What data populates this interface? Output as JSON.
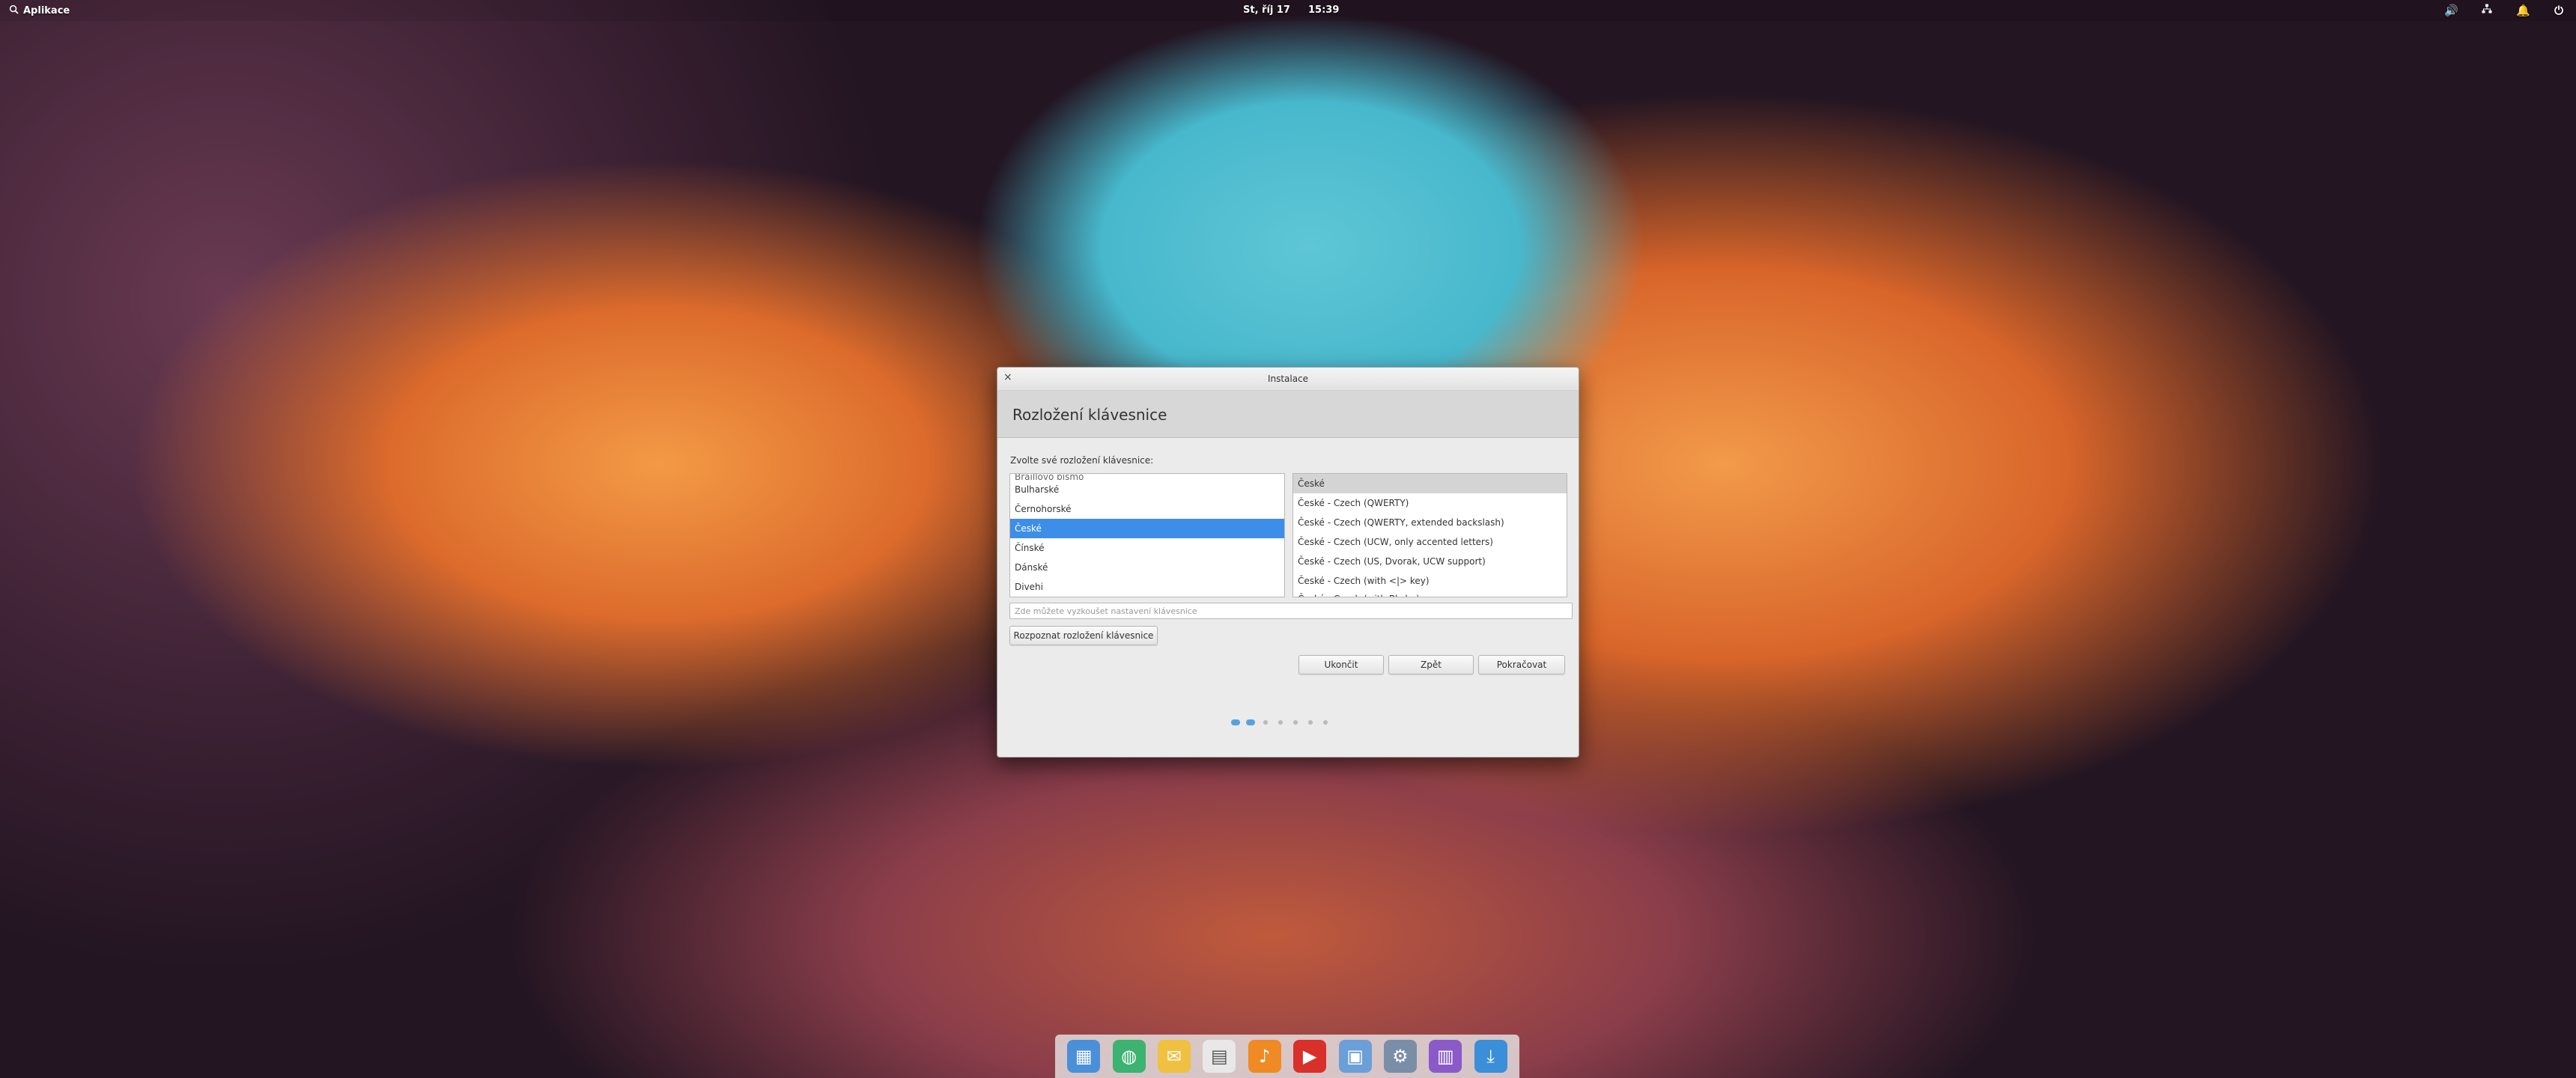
{
  "panel": {
    "apps_label": "Aplikace",
    "date": "St, říj 17",
    "time": "15:39"
  },
  "window": {
    "title": "Instalace",
    "heading": "Rozložení klávesnice",
    "prompt": "Zvolte své rozložení klávesnice:",
    "layouts": [
      "Braillovo písmo",
      "Bulharské",
      "Černohorské",
      "České",
      "Čínské",
      "Dánské",
      "Divehi"
    ],
    "selected_layout": "České",
    "variants": [
      "České",
      "České - Czech (QWERTY)",
      "České - Czech (QWERTY, extended backslash)",
      "České - Czech (UCW, only accented letters)",
      "České - Czech (US, Dvorak, UCW support)",
      "České - Czech (with <|> key)",
      "České - Czech (with Bksl...)"
    ],
    "test_placeholder": "Zde můžete vyzkoušet nastavení klávesnice",
    "detect_label": "Rozpoznat rozložení klávesnice",
    "quit_label": "Ukončit",
    "back_label": "Zpět",
    "continue_label": "Pokračovat",
    "progress": {
      "completed_steps": 2,
      "total_steps": 7
    }
  },
  "dock": {
    "apps": [
      {
        "name": "multitasking-view-icon",
        "color": "#4a90d9"
      },
      {
        "name": "web-browser-icon",
        "color": "#3cb371"
      },
      {
        "name": "mail-icon",
        "color": "#f0c040"
      },
      {
        "name": "calendar-icon",
        "color": "#e8e8e8"
      },
      {
        "name": "music-icon",
        "color": "#f08a24"
      },
      {
        "name": "videos-icon",
        "color": "#d9302c"
      },
      {
        "name": "photos-icon",
        "color": "#6a9fd8"
      },
      {
        "name": "settings-icon",
        "color": "#7a8ea8"
      },
      {
        "name": "app-center-icon",
        "color": "#8a5ac8"
      },
      {
        "name": "installer-icon",
        "color": "#3a8fd8"
      }
    ]
  }
}
